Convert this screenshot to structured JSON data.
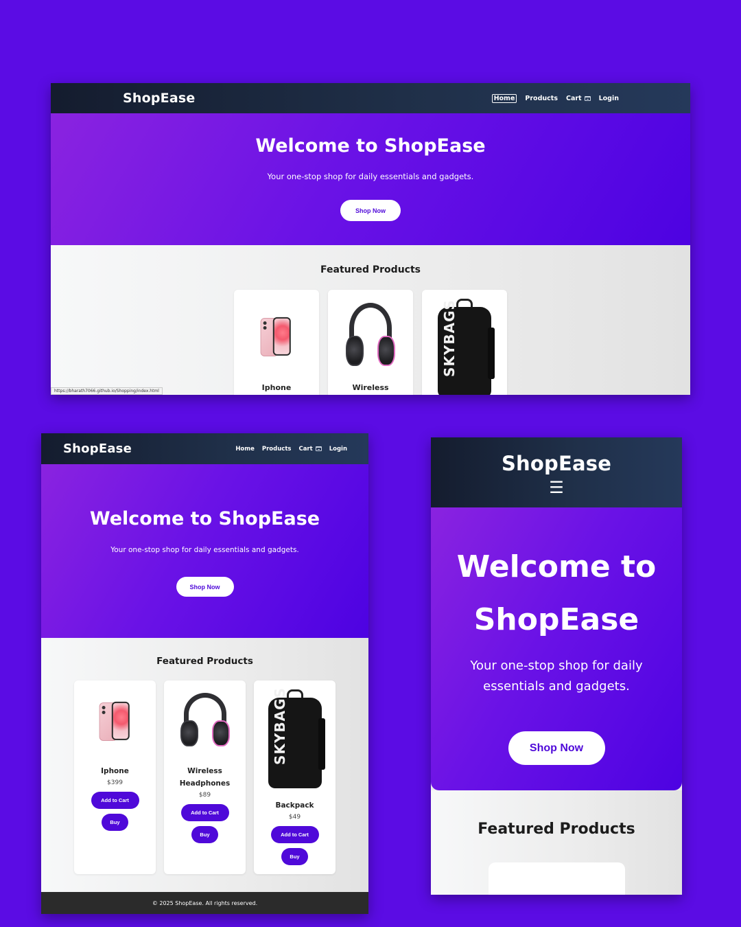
{
  "brand": "ShopEase",
  "nav": {
    "home": "Home",
    "products": "Products",
    "cart": "Cart",
    "login": "Login",
    "menu_icon": "☰"
  },
  "hero": {
    "title": "Welcome to ShopEase",
    "subtitle": "Your one-stop shop for daily essentials and gadgets.",
    "cta": "Shop Now"
  },
  "featured": {
    "title": "Featured Products",
    "products": [
      {
        "name": "Iphone",
        "price": "$399",
        "image_icon": "iphone-image"
      },
      {
        "name": "Wireless Headphones",
        "name_short": "Wireless",
        "price": "$89",
        "image_icon": "headphones-image"
      },
      {
        "name": "Backpack",
        "price": "$49",
        "image_icon": "backpack-image"
      }
    ],
    "add_to_cart": "Add to Cart",
    "buy": "Buy"
  },
  "footer": {
    "text": "© 2025 ShopEase. All rights reserved."
  },
  "status_bar": {
    "url": "https://bharath7066.github.io/Shopping/index.html"
  },
  "colors": {
    "background": "#5b0ce4",
    "accent": "#4f09d9",
    "navbar": "#1f2f48",
    "footer": "#2b2b2b"
  }
}
